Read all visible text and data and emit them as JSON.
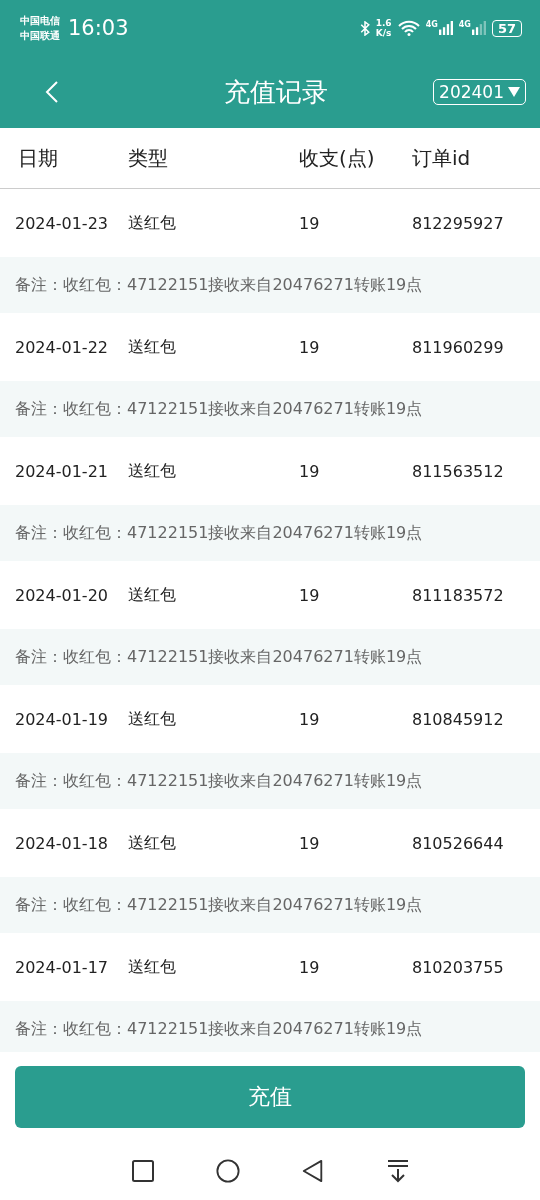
{
  "status_bar": {
    "carriers": [
      "中国电信",
      "中国联通"
    ],
    "time": "16:03",
    "speed": [
      "1.6",
      "K/s"
    ],
    "networks": [
      "4G",
      "4G"
    ],
    "battery": "57"
  },
  "header": {
    "title": "充值记录",
    "month": "202401"
  },
  "columns": [
    "日期",
    "类型",
    "收支(点)",
    "订单id"
  ],
  "records": [
    {
      "date": "2024-01-23",
      "type": "送红包",
      "amount": "19",
      "order_id": "812295927",
      "note": "备注：收红包：47122151接收来自20476271转账19点"
    },
    {
      "date": "2024-01-22",
      "type": "送红包",
      "amount": "19",
      "order_id": "811960299",
      "note": "备注：收红包：47122151接收来自20476271转账19点"
    },
    {
      "date": "2024-01-21",
      "type": "送红包",
      "amount": "19",
      "order_id": "811563512",
      "note": "备注：收红包：47122151接收来自20476271转账19点"
    },
    {
      "date": "2024-01-20",
      "type": "送红包",
      "amount": "19",
      "order_id": "811183572",
      "note": "备注：收红包：47122151接收来自20476271转账19点"
    },
    {
      "date": "2024-01-19",
      "type": "送红包",
      "amount": "19",
      "order_id": "810845912",
      "note": "备注：收红包：47122151接收来自20476271转账19点"
    },
    {
      "date": "2024-01-18",
      "type": "送红包",
      "amount": "19",
      "order_id": "810526644",
      "note": "备注：收红包：47122151接收来自20476271转账19点"
    },
    {
      "date": "2024-01-17",
      "type": "送红包",
      "amount": "19",
      "order_id": "810203755",
      "note": "备注：收红包：47122151接收来自20476271转账19点"
    }
  ],
  "recharge_button": "充值"
}
